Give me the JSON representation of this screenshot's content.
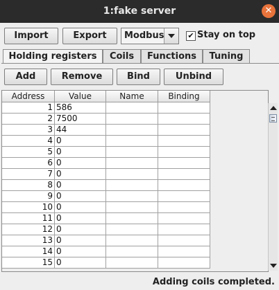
{
  "window": {
    "title": "1:fake server"
  },
  "toolbar": {
    "import_label": "Import",
    "export_label": "Export",
    "protocol": "Modbus",
    "stay_on_top_label": "Stay on top",
    "stay_on_top_mark": "✔"
  },
  "tabs": [
    "Holding registers",
    "Coils",
    "Functions",
    "Tuning"
  ],
  "actions": {
    "add": "Add",
    "remove": "Remove",
    "bind": "Bind",
    "unbind": "Unbind"
  },
  "table": {
    "columns": [
      "Address",
      "Value",
      "Name",
      "Binding"
    ],
    "rows": [
      {
        "address": "1",
        "value": "586",
        "name": "",
        "binding": ""
      },
      {
        "address": "2",
        "value": "7500",
        "name": "",
        "binding": ""
      },
      {
        "address": "3",
        "value": "44",
        "name": "",
        "binding": ""
      },
      {
        "address": "4",
        "value": "0",
        "name": "",
        "binding": ""
      },
      {
        "address": "5",
        "value": "0",
        "name": "",
        "binding": ""
      },
      {
        "address": "6",
        "value": "0",
        "name": "",
        "binding": ""
      },
      {
        "address": "7",
        "value": "0",
        "name": "",
        "binding": ""
      },
      {
        "address": "8",
        "value": "0",
        "name": "",
        "binding": ""
      },
      {
        "address": "9",
        "value": "0",
        "name": "",
        "binding": ""
      },
      {
        "address": "10",
        "value": "0",
        "name": "",
        "binding": ""
      },
      {
        "address": "11",
        "value": "0",
        "name": "",
        "binding": ""
      },
      {
        "address": "12",
        "value": "0",
        "name": "",
        "binding": ""
      },
      {
        "address": "13",
        "value": "0",
        "name": "",
        "binding": ""
      },
      {
        "address": "14",
        "value": "0",
        "name": "",
        "binding": ""
      },
      {
        "address": "15",
        "value": "0",
        "name": "",
        "binding": ""
      }
    ]
  },
  "status": {
    "text": "Adding coils completed."
  },
  "icons": {
    "close": "close-icon",
    "dropdown": "chevron-down-icon",
    "scroll_up": "arrow-up-icon",
    "scroll_down": "arrow-down-icon"
  }
}
